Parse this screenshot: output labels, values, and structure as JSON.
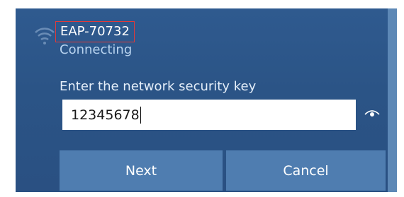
{
  "network": {
    "ssid": "EAP-70732",
    "status": "Connecting",
    "prompt": "Enter the network security key",
    "key_value": "12345678"
  },
  "buttons": {
    "next_label": "Next",
    "cancel_label": "Cancel"
  },
  "icons": {
    "wifi": "wifi-signal-icon",
    "reveal": "eye-icon"
  },
  "colors": {
    "panel_background": "#2b5486",
    "button_background": "#4f7db0",
    "highlight_border": "#e03a3a"
  }
}
